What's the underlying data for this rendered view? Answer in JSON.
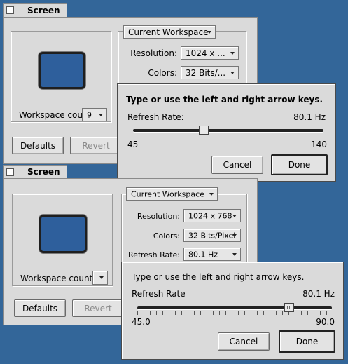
{
  "colors": {
    "desktop": "#336699",
    "window": "#dadada",
    "monitor": "#2e5f9c"
  },
  "window1": {
    "title": "Screen",
    "workspace_popup": "Current Workspace",
    "resolution_label": "Resolution:",
    "resolution_value": "1024 x ...",
    "colors_label": "Colors:",
    "colors_value": "32 Bits/...",
    "workspace_count_label": "Workspace coun",
    "workspace_count_value": "9",
    "defaults_button": "Defaults",
    "revert_button": "Revert"
  },
  "dialog1": {
    "prompt": "Type or use the left and right arrow keys.",
    "rate_label": "Refresh Rate:",
    "rate_value": "80.1 Hz",
    "min": "45",
    "max": "140",
    "slider_fraction": 0.37,
    "cancel_button": "Cancel",
    "done_button": "Done"
  },
  "window2": {
    "title": "Screen",
    "workspace_popup": "Current Workspace",
    "resolution_label": "Resolution:",
    "resolution_value": "1024 x 768",
    "colors_label": "Colors:",
    "colors_value": "32 Bits/Pixel",
    "refresh_label": "Refresh Rate:",
    "refresh_value": "80.1 Hz",
    "workspace_count_label": "Workspace count:",
    "defaults_button": "Defaults",
    "revert_button": "Revert"
  },
  "dialog2": {
    "prompt": "Type or use the left and right arrow keys.",
    "rate_label": "Refresh Rate",
    "rate_value": "80.1 Hz",
    "min": "45.0",
    "max": "90.0",
    "slider_fraction": 0.78,
    "cancel_button": "Cancel",
    "done_button": "Done"
  }
}
